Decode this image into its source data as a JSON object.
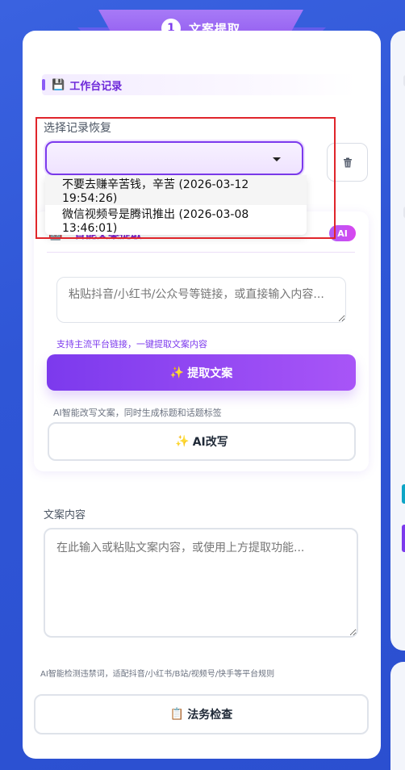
{
  "header": {
    "step_number": "1",
    "step_title": "文案提取"
  },
  "workspace": {
    "section_title": "工作台记录",
    "select_label": "选择记录恢复",
    "select_value": "",
    "options": [
      "不要去赚辛苦钱，辛苦 (2026-03-12 19:54:26)",
      "微信视频号是腾讯推出 (2026-03-08 13:46:01)"
    ]
  },
  "ai_extract": {
    "title": "智能文案提取",
    "badge": "AI",
    "input_placeholder": "粘贴抖音/小红书/公众号等链接，或直接输入内容...",
    "support_hint": "支持主流平台链接，一键提取文案内容",
    "extract_button": "提取文案",
    "rewrite_hint": "AI智能改写文案，同时生成标题和话题标签",
    "rewrite_button": "AI改写"
  },
  "content": {
    "label": "文案内容",
    "placeholder": "在此输入或粘贴文案内容，或使用上方提取功能...",
    "check_hint": "AI智能检测违禁词，适配抖音/小红书/B站/视频号/快手等平台规则",
    "legal_button": "法务检查"
  },
  "colors": {
    "accent": "#7c3aed",
    "highlight": "#e0252b",
    "background": "#2f56d6"
  }
}
